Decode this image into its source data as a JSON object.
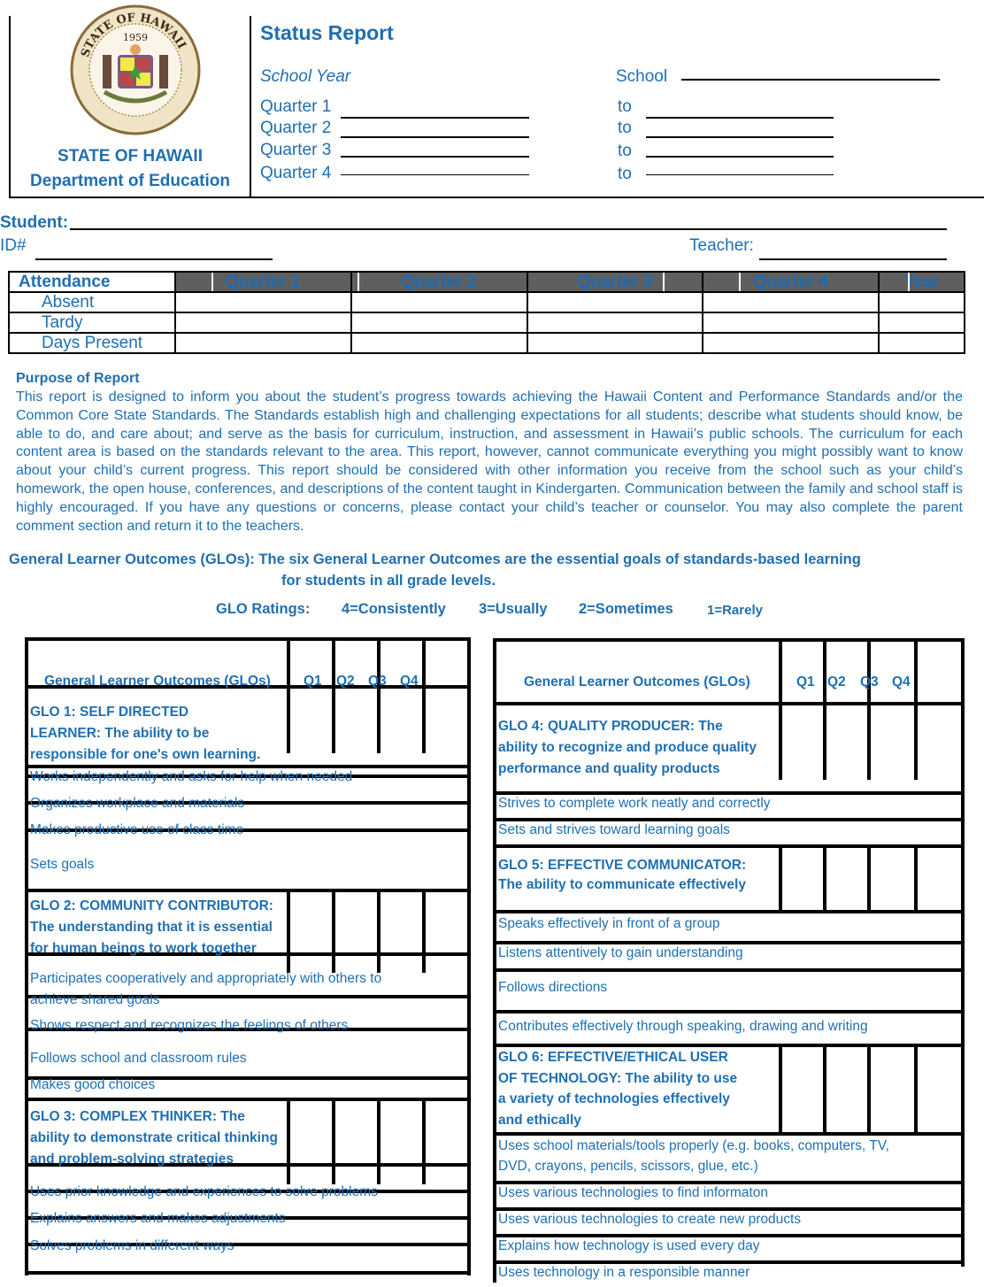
{
  "header": {
    "seal": {
      "icon": "state-seal-icon",
      "ring_text": "STATE OF HAWAII",
      "year": "1959"
    },
    "state_name": "STATE OF HAWAII",
    "department": "Department of Education",
    "title": "Status Report",
    "school_year_label": "School Year",
    "school_label": "School",
    "school_value": "",
    "quarters": [
      {
        "label": "Quarter 1",
        "start": "",
        "to": "to",
        "end": ""
      },
      {
        "label": "Quarter 2",
        "start": "",
        "to": "to",
        "end": ""
      },
      {
        "label": "Quarter 3",
        "start": "",
        "to": "to",
        "end": ""
      },
      {
        "label": "Quarter 4",
        "start": "",
        "to": "to",
        "end": ""
      }
    ]
  },
  "student": {
    "student_label": "Student:",
    "student_value": "",
    "id_label": "ID#",
    "id_value": "",
    "teacher_label": "Teacher:",
    "teacher_value": ""
  },
  "attendance": {
    "title": "Attendance",
    "columns": [
      "Quarter 1",
      "Quarter 2",
      "Quarter 3",
      "Quarter 4",
      "Year"
    ],
    "rows": [
      {
        "label": "Absent",
        "values": [
          "",
          "",
          "",
          "",
          ""
        ]
      },
      {
        "label": "Tardy",
        "values": [
          "",
          "",
          "",
          "",
          ""
        ]
      },
      {
        "label": "Days Present",
        "values": [
          "",
          "",
          "",
          "",
          ""
        ]
      }
    ]
  },
  "purpose": {
    "title": "Purpose of Report",
    "body": "This report is designed to inform you about the student’s progress towards achieving the Hawaii Content and Performance Standards and/or the Common Core State Standards. The Standards establish high and challenging expectations for all students; describe what students should know, be able to do, and care about; and serve as the basis for curriculum, instruction, and assessment in Hawaii’s public schools. The curriculum for each content area is based on the standards relevant to the area. This report, however, cannot communicate everything you might possibly want to know about your child’s current progress. This report should be considered with other information you receive from the school such as your child’s homework, the open house, conferences, and descriptions of the content taught in Kindergarten. Communication between the family and school staff is highly encouraged. If you have any questions or concerns, please contact your child’s teacher or counselor. You may also complete the parent comment section and return it to the teachers."
  },
  "glo_intro": {
    "line1": "General Learner Outcomes (GLOs): The six General Learner Outcomes are the essential goals of standards-based learning",
    "line2": "for students in all grade levels."
  },
  "ratings": {
    "label": "GLO Ratings:",
    "items": [
      "4=Consistently",
      "3=Usually",
      "2=Sometimes",
      "1=Rarely"
    ]
  },
  "glo_table": {
    "column_header": "General Learner Outcomes (GLOs)",
    "quarters": [
      "Q1",
      "Q2",
      "Q3",
      "Q4"
    ],
    "glos": [
      {
        "heading": [
          "GLO 1: SELF DIRECTED",
          "LEARNER: The ability to be",
          "responsible for one's own learning."
        ],
        "items": [
          "Works independently and asks for help when needed",
          "Organizes workplace and materials",
          "Makes productive use of class time",
          "Sets goals"
        ],
        "ratings": [
          "",
          "",
          "",
          ""
        ]
      },
      {
        "heading": [
          "GLO 2: COMMUNITY CONTRIBUTOR:",
          "The understanding that it is essential",
          "for human beings to work together"
        ],
        "items": [
          "Participates cooperatively and appropriately with others to",
          "achieve shared goals",
          "Shows respect and recognizes the feelings of others",
          "Follows school and classroom rules",
          "Makes good choices"
        ],
        "ratings": [
          "",
          "",
          "",
          ""
        ]
      },
      {
        "heading": [
          "GLO 3: COMPLEX THINKER: The",
          "ability to demonstrate critical thinking",
          "and problem-solving strategies"
        ],
        "items": [
          "Uses prior knowledge and experiences to solve problems",
          "Explains answers and makes adjustments",
          "Solves problems in different ways"
        ],
        "ratings": [
          "",
          "",
          "",
          ""
        ]
      },
      {
        "heading": [
          "GLO 4: QUALITY PRODUCER: The",
          "ability to recognize and produce quality",
          "performance and quality products"
        ],
        "items": [
          "Strives to complete work neatly and correctly",
          "Sets and strives toward learning goals"
        ],
        "ratings": [
          "",
          "",
          "",
          ""
        ]
      },
      {
        "heading": [
          "GLO 5: EFFECTIVE COMMUNICATOR:",
          "The ability to communicate effectively"
        ],
        "items": [
          "Speaks effectively in front of a group",
          "Listens attentively to gain understanding",
          "Follows directions",
          "Contributes effectively through speaking, drawing and writing"
        ],
        "ratings": [
          "",
          "",
          "",
          ""
        ]
      },
      {
        "heading": [
          "GLO 6: EFFECTIVE/ETHICAL USER",
          "OF TECHNOLOGY: The ability to use",
          "a variety of technologies effectively",
          "and ethically"
        ],
        "items": [
          "Uses school materials/tools properly (e.g. books, computers, TV,",
          "DVD, crayons, pencils, scissors, glue, etc.)",
          "Uses various technologies to find informaton",
          "Uses various technologies to create new products",
          "Explains how technology is used every day",
          "Uses technology in a responsible manner"
        ],
        "ratings": [
          "",
          "",
          "",
          ""
        ]
      }
    ]
  },
  "colors": {
    "text_blue": "#1f6fb2",
    "header_gray": "#5f5f5f",
    "rule_black": "#000000"
  }
}
